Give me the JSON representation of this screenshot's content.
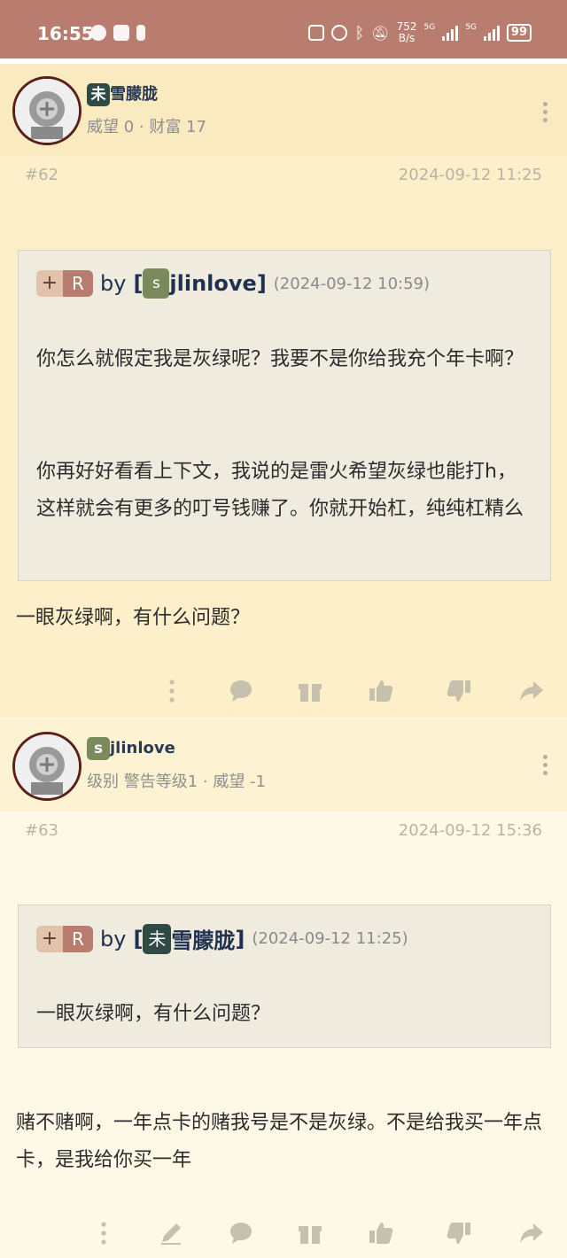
{
  "status_bar": {
    "time": "16:55",
    "net_speed_value": "752",
    "net_speed_unit": "B/s",
    "gen1": "5G",
    "gen2": "5G",
    "battery": "99"
  },
  "posts": [
    {
      "badge": "未",
      "username": "雪朦胧",
      "meta": "威望 0 · 财富 17",
      "floor": "#62",
      "time": "2024-09-12 11:25",
      "quote": {
        "plus": "+",
        "r": "R",
        "by": "by",
        "bracket_open": "[",
        "badge": "s",
        "name": "jlinlove",
        "bracket_close": "]",
        "date": "(2024-09-12 10:59)",
        "para1": "你怎么就假定我是灰绿呢？我要不是你给我充个年卡啊？",
        "para2": "你再好好看看上下文，我说的是雷火希望灰绿也能打h，这样就会有更多的叮号钱赚了。你就开始杠，纯纯杠精么"
      },
      "text": "一眼灰绿啊，有什么问题？"
    },
    {
      "badge": "s",
      "username": "jlinlove",
      "meta": "级别 警告等级1 · 威望 -1",
      "floor": "#63",
      "time": "2024-09-12 15:36",
      "quote": {
        "plus": "+",
        "r": "R",
        "by": "by",
        "bracket_open": "[",
        "badge": "未",
        "name": "雪朦胧",
        "bracket_close": "]",
        "date": "(2024-09-12 11:25)",
        "para1": "一眼灰绿啊，有什么问题？"
      },
      "text": "赌不赌啊，一年点卡的赌我号是不是灰绿。不是给我买一年点卡，是我给你买一年"
    }
  ],
  "colors": {
    "status_bar": "#b87d6e",
    "post_bg_1": "#fcefc9",
    "post_bg_2": "#fef8e6",
    "username": "#2a3a55",
    "icon_gray": "#b7b0a0"
  },
  "action_icons": [
    "more-icon",
    "edit-icon",
    "comment-icon",
    "gift-icon",
    "thumbs-up-icon",
    "thumbs-down-icon",
    "share-icon"
  ]
}
